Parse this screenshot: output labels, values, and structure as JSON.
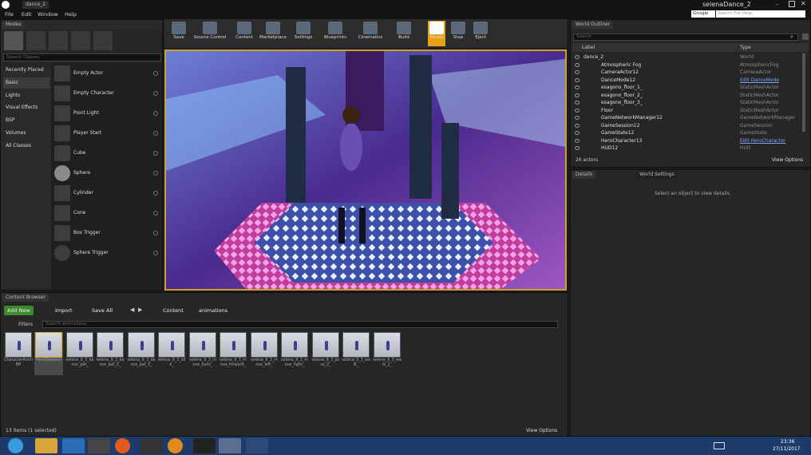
{
  "window": {
    "title": "dance_2",
    "project_name": "selenaDance_2",
    "search_engine": "Google",
    "help_placeholder": "Search For Help"
  },
  "menu": [
    "File",
    "Edit",
    "Window",
    "Help"
  ],
  "modes": {
    "tab": "Modes",
    "search_placeholder": "Search Classes",
    "categories": [
      "Recently Placed",
      "Basic",
      "Lights",
      "Visual Effects",
      "BSP",
      "Volumes",
      "All Classes"
    ],
    "selected_category": "Basic",
    "items": [
      "Empty Actor",
      "Empty Character",
      "Point Light",
      "Player Start",
      "Cube",
      "Sphere",
      "Cylinder",
      "Cone",
      "Box Trigger",
      "Sphere Trigger"
    ]
  },
  "toolbar": [
    "Save",
    "Source Control",
    "Content",
    "Marketplace",
    "Settings",
    "Blueprints",
    "Cinematics",
    "Build",
    "Pause",
    "Stop",
    "Eject"
  ],
  "toolbar_active": "Pause",
  "outliner": {
    "tab": "World Outliner",
    "search_placeholder": "Search",
    "col_label": "Label",
    "col_type": "Type",
    "rows": [
      {
        "label": "dance_2",
        "type": "World"
      },
      {
        "label": "Atmospheric Fog",
        "type": "AtmosphericFog"
      },
      {
        "label": "CameraActor12",
        "type": "CameraActor"
      },
      {
        "label": "DanceMode12",
        "type": "Edit DanceMode"
      },
      {
        "label": "esagono_floor_1_",
        "type": "StaticMeshActor"
      },
      {
        "label": "esagono_floor_2_",
        "type": "StaticMeshActor"
      },
      {
        "label": "esagono_floor_3_",
        "type": "StaticMeshActor"
      },
      {
        "label": "Floor",
        "type": "StaticMeshActor"
      },
      {
        "label": "GameNetworkManager12",
        "type": "GameNetworkManager"
      },
      {
        "label": "GameSession12",
        "type": "GameSession"
      },
      {
        "label": "GameState12",
        "type": "GameState"
      },
      {
        "label": "HeroCharacter13",
        "type": "Edit HeroCharacter"
      },
      {
        "label": "HUD12",
        "type": "HUD"
      }
    ],
    "count": "26 actors",
    "view_options": "View Options"
  },
  "details": {
    "tab": "Details",
    "tab2": "World Settings",
    "empty_msg": "Select an object to view details."
  },
  "content_browser": {
    "tab": "Content Browser",
    "add_new": "Add New",
    "import": "Import",
    "save_all": "Save All",
    "path": [
      "Content",
      "animations"
    ],
    "filters": "Filters",
    "search_placeholder": "Search animations",
    "assets": [
      "CharacterAnimBP",
      "HeroSkeleton",
      "selena_9_3_dance_pat_",
      "selena_9_3_dance_pat_2_",
      "selena_9_3_dance_pat_3_",
      "selena_9_3_idle_",
      "selena_9_3_move_back_",
      "selena_9_3_move_forward_",
      "selena_9_3_move_left_",
      "selena_9_3_move_right_",
      "selena_9_3_pose_2_",
      "selena_9_3_walk_",
      "selena_9_3_walk_2_"
    ],
    "status": "13 items (1 selected)",
    "view_options": "View Options"
  },
  "taskbar": {
    "time": "23:36",
    "date": "27/11/2017"
  }
}
